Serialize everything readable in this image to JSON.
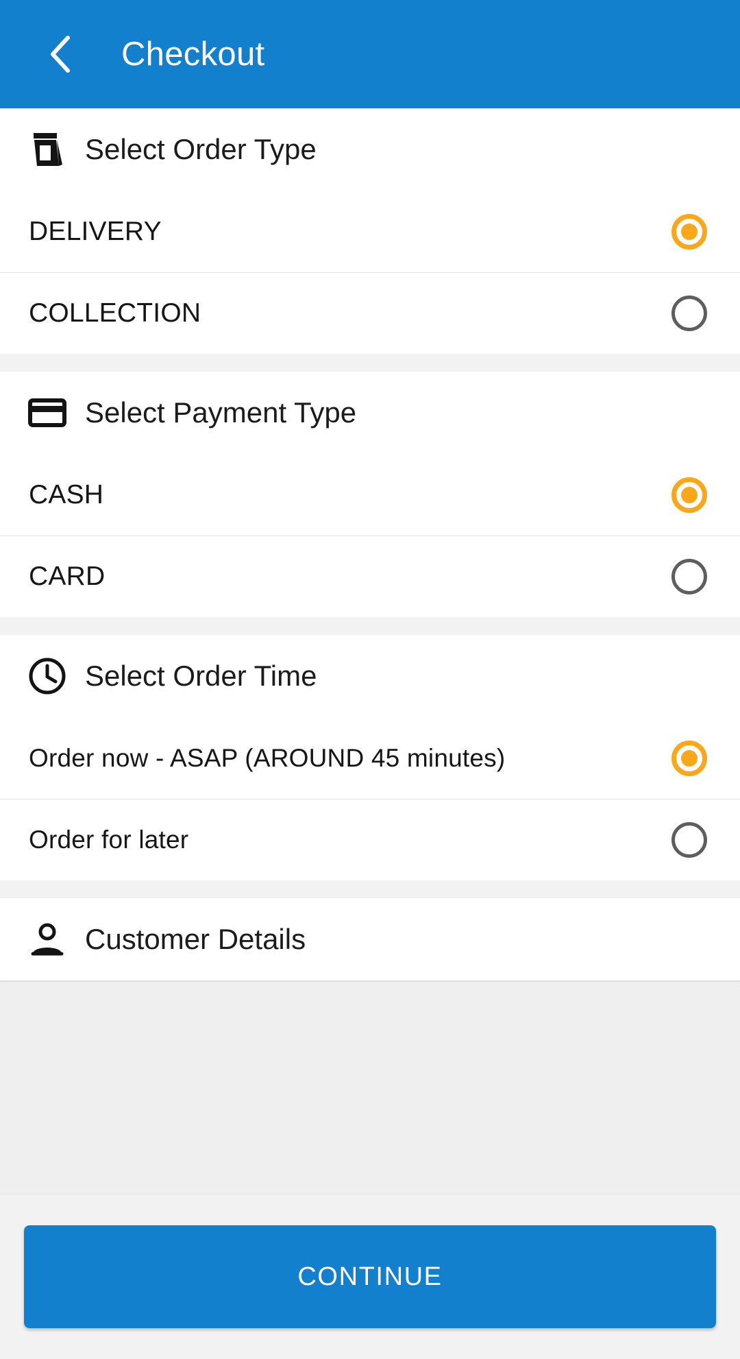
{
  "appbar": {
    "title": "Checkout",
    "back_icon": "chevron-left-icon",
    "background_color": "#1380CE",
    "text_color": "#FFFFFF"
  },
  "colors": {
    "primary_blue": "#1380CE",
    "selected_radio_orange": "#FAA71B",
    "unselected_radio_gray": "#5E5E5E",
    "section_gap_gray": "#F2F2F2",
    "divider_gray": "#E6E6E6",
    "text_dark": "#161616"
  },
  "sections": [
    {
      "id": "order-type",
      "icon": "takeaway-bag-icon",
      "title": "Select Order Type",
      "options": [
        {
          "label": "DELIVERY",
          "selected": true
        },
        {
          "label": "COLLECTION",
          "selected": false
        }
      ]
    },
    {
      "id": "payment-type",
      "icon": "credit-card-icon",
      "title": "Select Payment Type",
      "options": [
        {
          "label": "CASH",
          "selected": true
        },
        {
          "label": "CARD",
          "selected": false
        }
      ]
    },
    {
      "id": "order-time",
      "icon": "clock-icon",
      "title": "Select Order Time",
      "options": [
        {
          "label": "Order now - ASAP (AROUND 45 minutes)",
          "selected": true
        },
        {
          "label": "Order for later",
          "selected": false
        }
      ]
    },
    {
      "id": "customer-details",
      "icon": "person-icon",
      "title": "Customer Details",
      "options": []
    }
  ],
  "footer": {
    "continue_label": "CONTINUE"
  }
}
